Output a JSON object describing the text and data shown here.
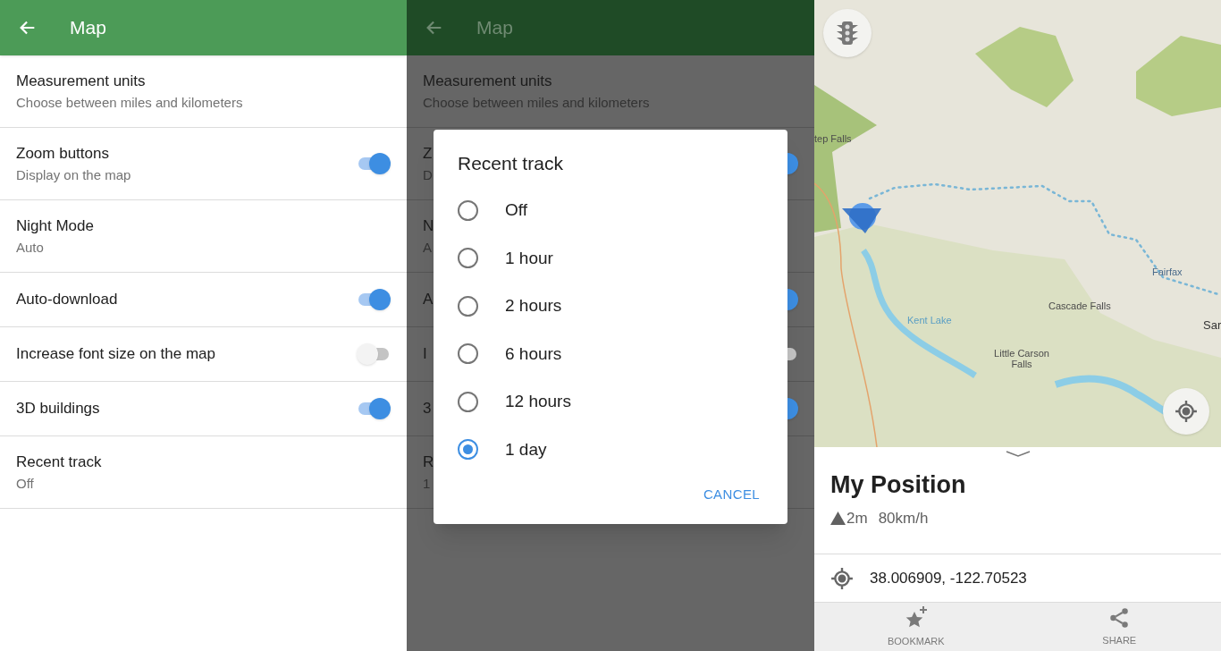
{
  "settings_screen": {
    "title": "Map",
    "items": [
      {
        "kind": "plain",
        "title": "Measurement units",
        "subtitle": "Choose between miles and kilometers"
      },
      {
        "kind": "toggle",
        "title": "Zoom buttons",
        "subtitle": "Display on the map",
        "on": true
      },
      {
        "kind": "plain",
        "title": "Night Mode",
        "subtitle": "Auto"
      },
      {
        "kind": "toggle",
        "title": "Auto-download",
        "on": true
      },
      {
        "kind": "toggle",
        "title": "Increase font size on the map",
        "on": false
      },
      {
        "kind": "toggle",
        "title": "3D buildings",
        "on": true
      },
      {
        "kind": "plain",
        "title": "Recent track",
        "subtitle": "Off"
      }
    ]
  },
  "dialog_screen": {
    "title": "Map",
    "items": [
      {
        "kind": "plain",
        "title": "Measurement units",
        "subtitle": "Choose between miles and kilometers"
      },
      {
        "kind": "toggle",
        "title": "Z",
        "subtitle": "D",
        "on": true
      },
      {
        "kind": "plain",
        "title": "N",
        "subtitle": "A"
      },
      {
        "kind": "toggle",
        "title": "A",
        "on": true
      },
      {
        "kind": "toggle",
        "title": "I",
        "on": false
      },
      {
        "kind": "toggle",
        "title": "3",
        "on": true
      },
      {
        "kind": "plain",
        "title": "R",
        "subtitle": "1"
      }
    ],
    "dialog": {
      "title": "Recent track",
      "options": [
        {
          "label": "Off",
          "selected": false
        },
        {
          "label": "1 hour",
          "selected": false
        },
        {
          "label": "2 hours",
          "selected": false
        },
        {
          "label": "6 hours",
          "selected": false
        },
        {
          "label": "12 hours",
          "selected": false
        },
        {
          "label": "1 day",
          "selected": true
        }
      ],
      "cancel": "CANCEL"
    }
  },
  "map_screen": {
    "labels": [
      {
        "text": "tep Falls"
      },
      {
        "text": "Fairfax"
      },
      {
        "text": "Kent Lake"
      },
      {
        "text": "Cascade Falls"
      },
      {
        "text": "Little Carson Falls"
      },
      {
        "text": "Sar"
      }
    ],
    "place": {
      "title": "My Position",
      "altitude": "2m",
      "speed": "80km/h",
      "coordinates": "38.006909, -122.70523"
    },
    "actions": [
      {
        "kind": "bookmark",
        "label": "BOOKMARK"
      },
      {
        "kind": "share",
        "label": "SHARE"
      }
    ]
  }
}
